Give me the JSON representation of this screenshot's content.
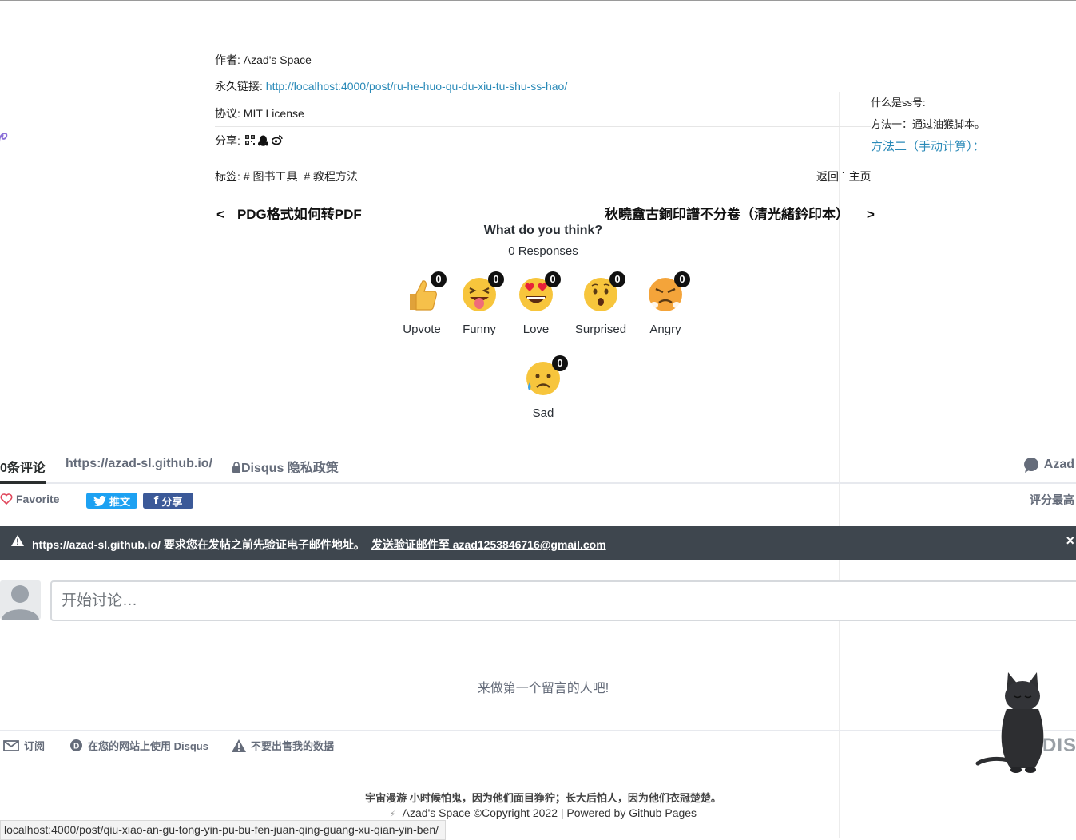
{
  "post_meta": {
    "author_label": "作者:",
    "author": "Azad's Space",
    "permalink_label": "永久链接:",
    "permalink": "http://localhost:4000/post/ru-he-huo-qu-du-xiu-tu-shu-ss-hao/",
    "license_label": "协议:",
    "license": "MIT License",
    "share_label": "分享:"
  },
  "toc": {
    "item1": "什么是ss号:",
    "item2": "方法一：通过油猴脚本。",
    "item3": "方法二（手动计算）："
  },
  "tags": {
    "label": "标签:",
    "items": [
      "# 图书工具",
      "# 教程方法"
    ]
  },
  "back_home": "返回 ˙ 主页",
  "nav": {
    "prev_arrow": "<",
    "prev_title": "PDG格式如何转PDF",
    "next_title": "秋曉盦古銅印譜不分卷（清光緒鈐印本）",
    "next_arrow": ">"
  },
  "reactions": {
    "title": "What do you think?",
    "responses": "0 Responses",
    "items": [
      {
        "label": "Upvote",
        "count": "0",
        "icon": "thumbs-up-icon"
      },
      {
        "label": "Funny",
        "count": "0",
        "icon": "tongue-face-icon"
      },
      {
        "label": "Love",
        "count": "0",
        "icon": "heart-eyes-icon"
      },
      {
        "label": "Surprised",
        "count": "0",
        "icon": "surprised-face-icon"
      },
      {
        "label": "Angry",
        "count": "0",
        "icon": "angry-face-icon"
      },
      {
        "label": "Sad",
        "count": "0",
        "icon": "sad-face-icon"
      }
    ]
  },
  "disqus": {
    "tab_comments": "0条评论",
    "tab_site": "https://azad-sl.github.io/",
    "tab_privacy": "Disqus 隐私政策",
    "user": "Azad",
    "favorite": "Favorite",
    "tweet": "推文",
    "share": "分享",
    "sort": "评分最高",
    "verify_message": "https://azad-sl.github.io/ 要求您在发帖之前先验证电子邮件地址。",
    "verify_link": "发送验证邮件至 azad1253846716@gmail.com",
    "close": "×",
    "comment_placeholder": "开始讨论…",
    "first_comment": "来做第一个留言的人吧!",
    "footer_subscribe": "订阅",
    "footer_use_disqus": "在您的网站上使用 Disqus",
    "footer_dont_sell": "不要出售我的数据",
    "logo_text": "DISQUS"
  },
  "footer": {
    "motto_prefix": "宇宙漫游",
    "motto": "小时候怕鬼，因为他们面目狰狞；长大后怕人，因为他们衣冠楚楚。",
    "bolt": "⚡",
    "copyright": "Azad's Space ©Copyright 2022 | Powered by Github Pages"
  },
  "status_bar_url": "localhost:4000/post/qiu-xiao-an-gu-tong-yin-pu-bu-fen-juan-qing-guang-xu-qian-yin-ben/",
  "colors": {
    "link": "#2a8ab8",
    "twitter": "#1da1f2",
    "facebook": "#3b5998",
    "verify_bar": "#3e464e"
  }
}
